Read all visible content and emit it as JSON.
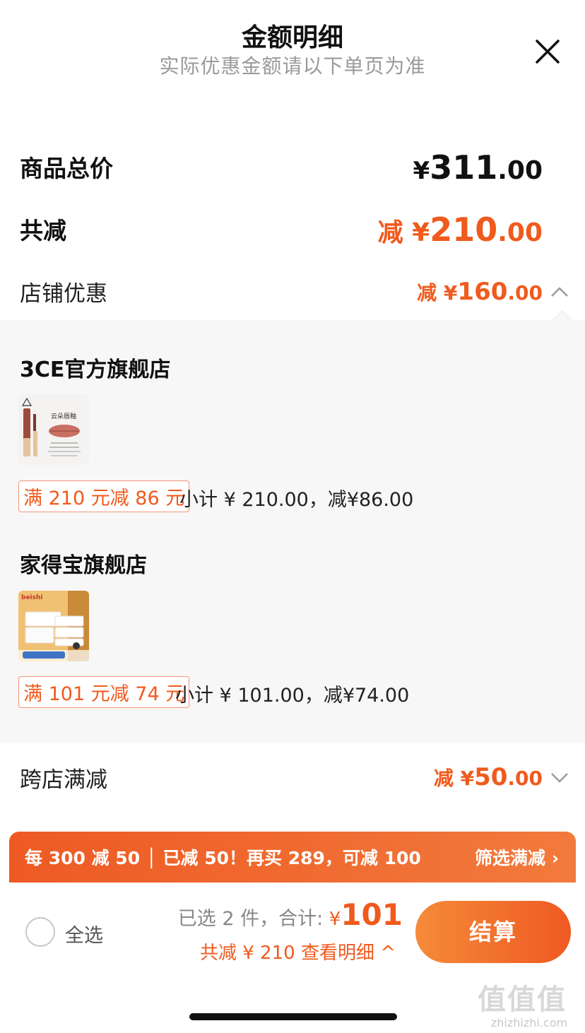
{
  "header": {
    "title": "金额明细",
    "subtitle": "实际优惠金额请以下单页为准",
    "close_icon": "close-icon"
  },
  "summary": {
    "total_label": "商品总价",
    "total_yen": "¥",
    "total_int": "311",
    "total_dec": ".00",
    "reduce_label": "共减",
    "reduce_prefix": "减 ¥",
    "reduce_int": "210",
    "reduce_dec": ".00",
    "store_label": "店铺优惠",
    "store_prefix": "减 ¥",
    "store_int": "160",
    "store_dec": ".00",
    "store_icon": "chevron-up-icon"
  },
  "stores": [
    {
      "name": "3CE官方旗舰店",
      "product_caption": "云朵唇釉",
      "tag": "满 210 元减 86 元",
      "subtotal": "小计 ¥ 210.00，减¥86.00"
    },
    {
      "name": "家得宝旗舰店",
      "product_brand": "beishi",
      "tag": "满 101 元减 74 元",
      "subtotal": "小计 ¥ 101.00，减¥74.00"
    }
  ],
  "cross_store": {
    "label": "跨店满减",
    "prefix": "减 ¥",
    "int": "50",
    "dec": ".00",
    "icon": "chevron-down-icon"
  },
  "banner": {
    "text": "每 300 减 50 │ 已减 50！再买 289，可减 100",
    "filter": "筛选满减 ›"
  },
  "bottom_bar": {
    "select_all": "全选",
    "selected_prefix": "已选 2 件，合计:",
    "yen": "¥",
    "total": "101",
    "detail": "共减 ¥ 210  查看明细 ^",
    "checkout": "结算"
  },
  "watermark": {
    "logo": "值值值",
    "url": "zhizhizhi.com"
  },
  "colors": {
    "accent": "#f05a1d",
    "panel_bg": "#f7f7f7",
    "banner_start": "#ee5a24",
    "banner_end": "#f27a3c"
  }
}
